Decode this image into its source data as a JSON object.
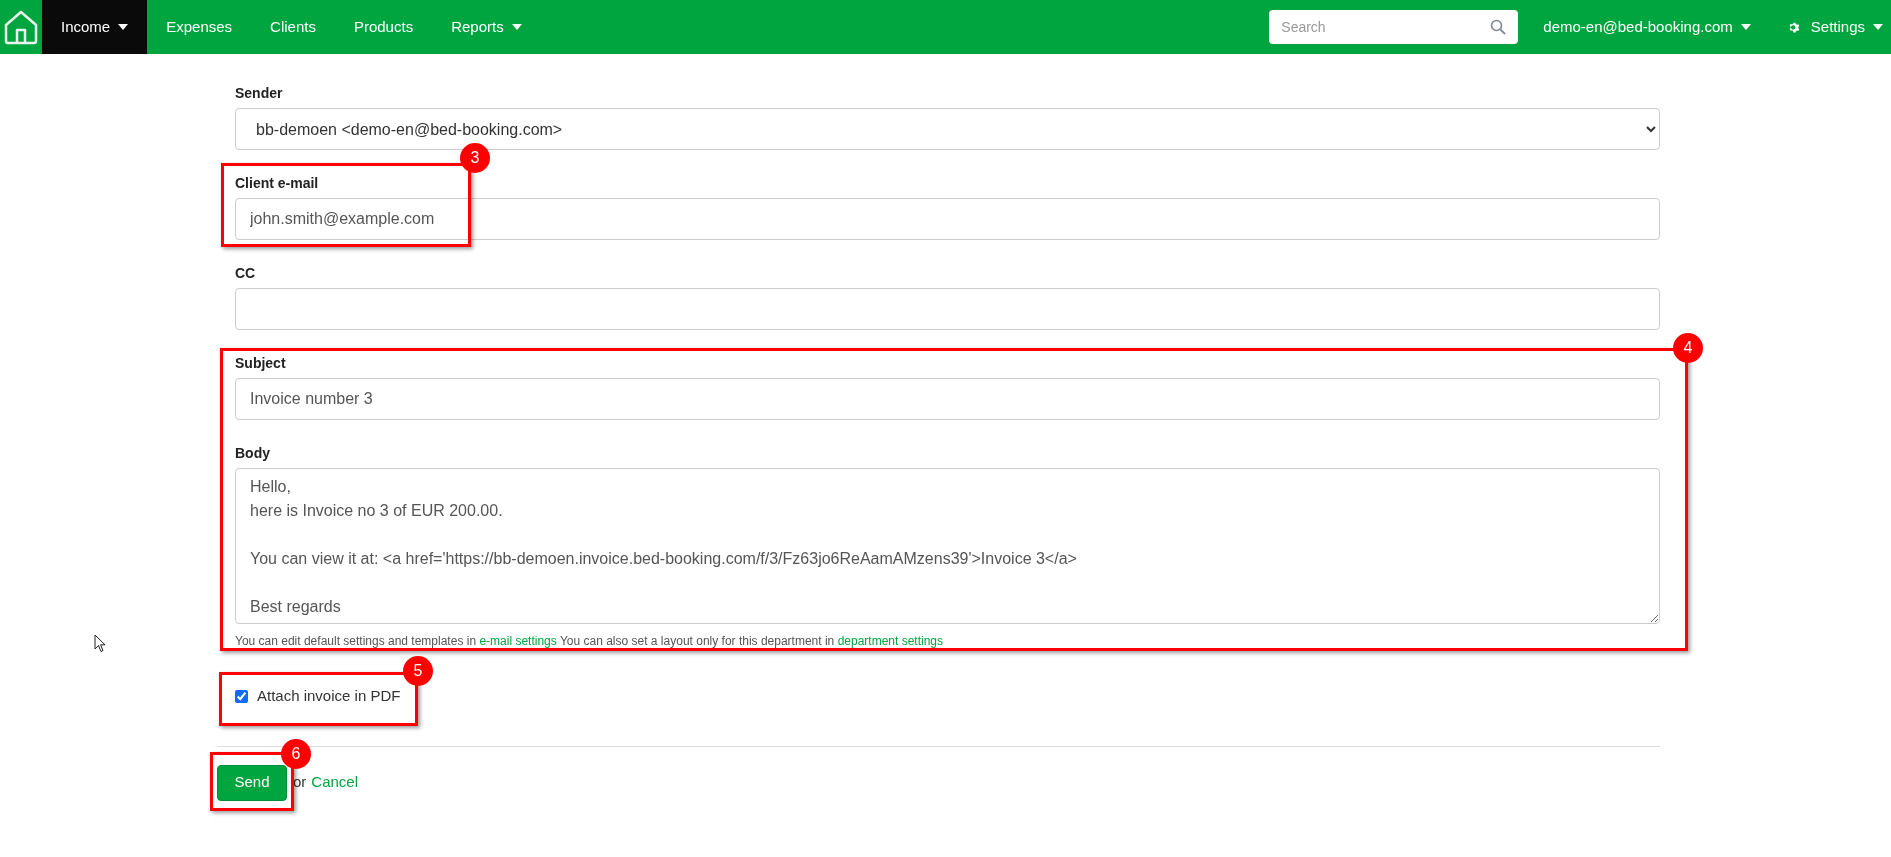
{
  "navbar": {
    "items": [
      {
        "label": "Income",
        "selected": true,
        "dropdown": true
      },
      {
        "label": "Expenses",
        "selected": false,
        "dropdown": false
      },
      {
        "label": "Clients",
        "selected": false,
        "dropdown": false
      },
      {
        "label": "Products",
        "selected": false,
        "dropdown": false
      },
      {
        "label": "Reports",
        "selected": false,
        "dropdown": true
      }
    ],
    "search": {
      "placeholder": "Search"
    },
    "account": "demo-en@bed-booking.com",
    "settings": "Settings"
  },
  "form": {
    "sender": {
      "label": "Sender",
      "value": "bb-demoen <demo-en@bed-booking.com>"
    },
    "client_email": {
      "label": "Client e-mail",
      "value": "john.smith@example.com"
    },
    "cc": {
      "label": "CC"
    },
    "subject": {
      "label": "Subject",
      "value": "Invoice number 3"
    },
    "body": {
      "label": "Body",
      "value": "Hello,\nhere is Invoice no 3 of EUR 200.00.\n\nYou can view it at: <a href='https://bb-demoen.invoice.bed-booking.com/f/3/Fz63jo6ReAamAMzens39'>Invoice 3</a>\n\nBest regards"
    },
    "help": {
      "parts": [
        {
          "kind": "text",
          "text": "You can edit default settings and templates in"
        },
        {
          "kind": "link",
          "text": "e-mail settings"
        },
        {
          "kind": "text",
          "text": "You can also set a layout only for this department in"
        },
        {
          "kind": "link",
          "text": "department settings"
        }
      ]
    },
    "attach": {
      "label": "Attach invoice in PDF",
      "checked": true
    },
    "send": "Send",
    "or": "or",
    "cancel": "Cancel"
  },
  "annotations": [
    {
      "number": "3"
    },
    {
      "number": "4"
    },
    {
      "number": "5"
    },
    {
      "number": "6"
    }
  ]
}
